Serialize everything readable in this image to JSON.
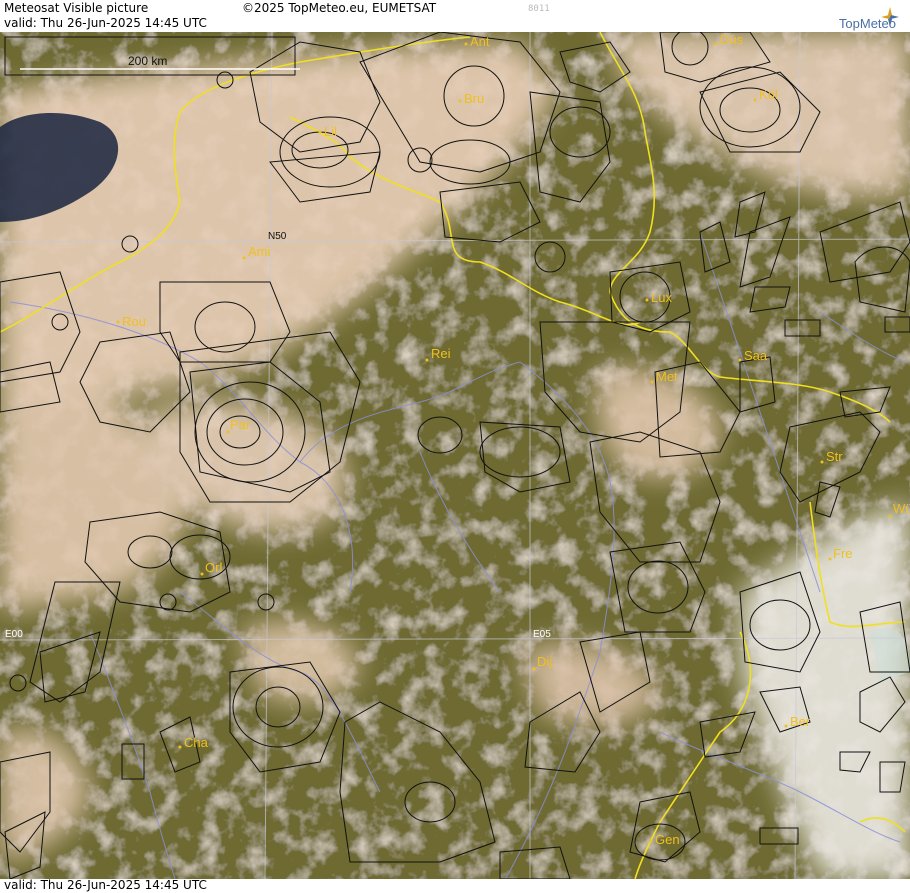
{
  "header": {
    "title": "Meteosat Visible picture",
    "copyright": "©2025 TopMeteo.eu, EUMETSAT",
    "code": "8011",
    "brand": "TopMeteo",
    "valid_top": "valid:  Thu  26-Jun-2025  14:45 UTC"
  },
  "footer": {
    "valid_bottom": "valid:  Thu  26-Jun-2025  14:45 UTC"
  },
  "map": {
    "scale_label": "200 km",
    "grid_labels": [
      "N50",
      "E00",
      "E05"
    ],
    "cities": [
      "Ant",
      "Düs",
      "Bru",
      "Köl",
      "Lil",
      "Ami",
      "Lux",
      "Rou",
      "Rei",
      "Saa",
      "Met",
      "Par",
      "Str",
      "Fre",
      "Orl",
      "Dij",
      "Ber",
      "Cha",
      "Gen",
      "Wü"
    ]
  },
  "colors": {
    "city_label": "#f0c020",
    "border": "#f0e020",
    "rivers": "#8a8fd8",
    "airspace": "#111111",
    "land": "#6e6a32",
    "cloud": "#e2cbb4",
    "sea": "#1a2540"
  }
}
